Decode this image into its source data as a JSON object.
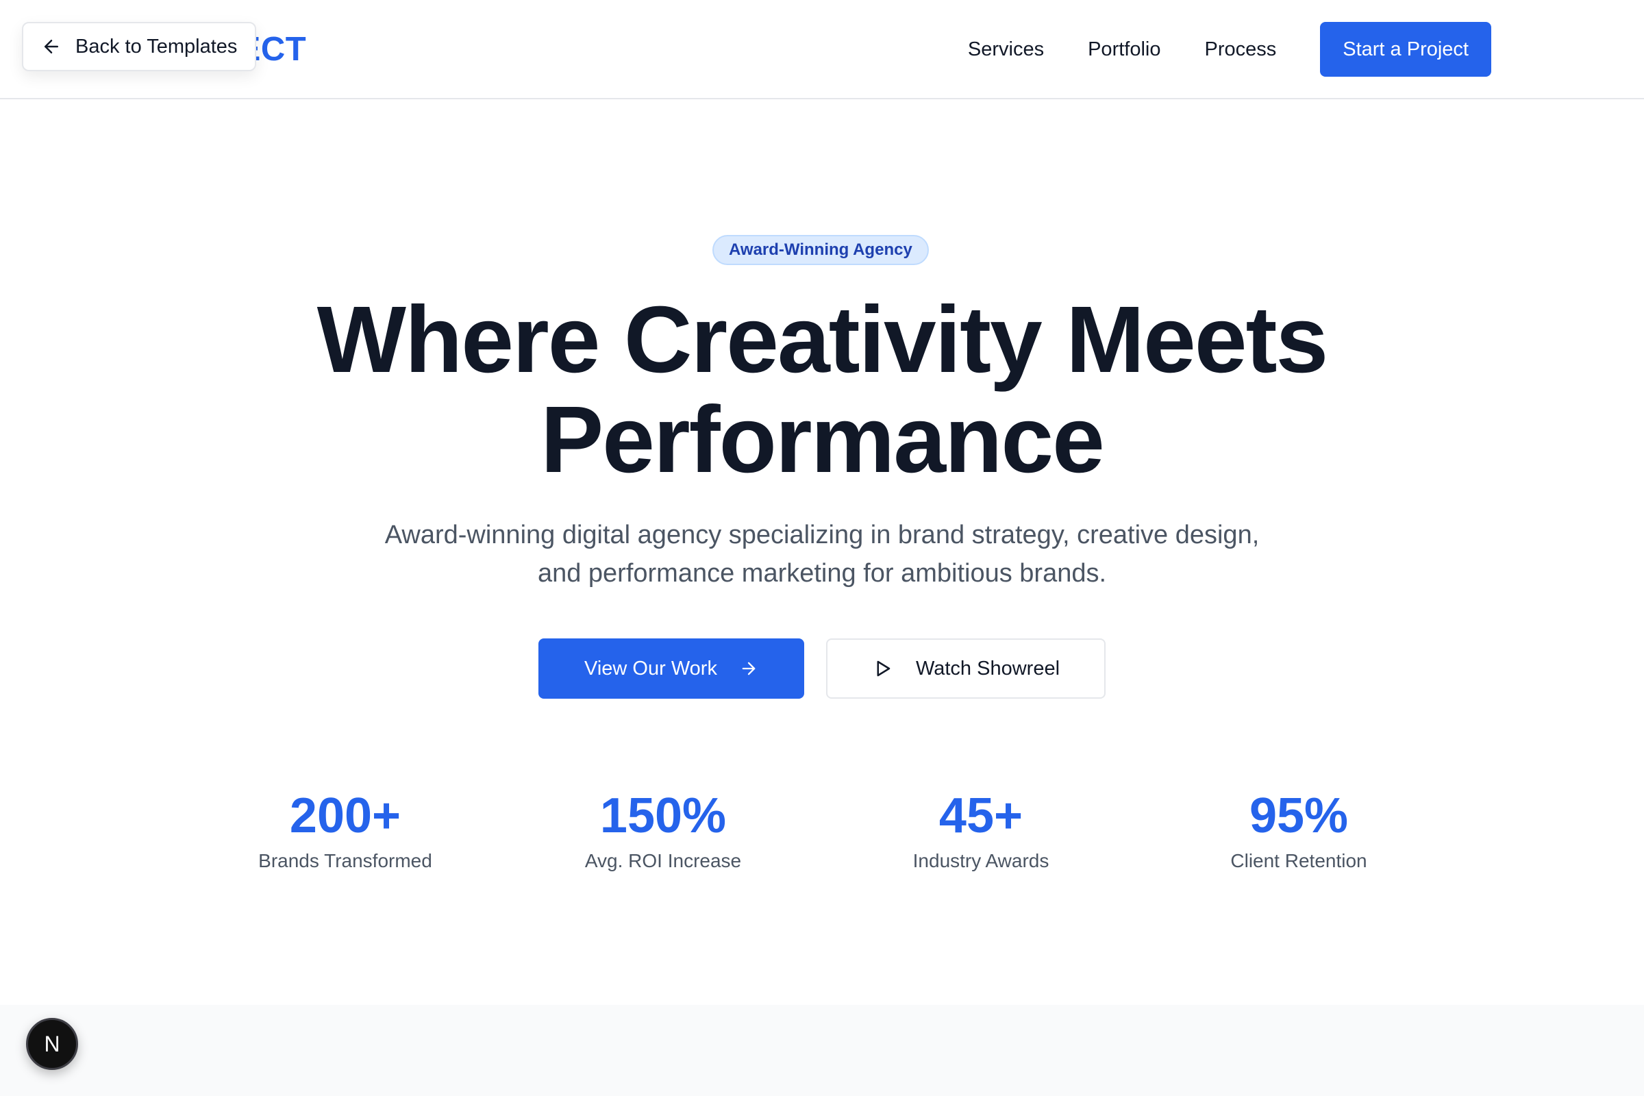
{
  "header": {
    "logo_text": "PERFECT",
    "nav": [
      "Services",
      "Portfolio",
      "Process"
    ],
    "cta_label": "Start a Project"
  },
  "overlay": {
    "back_label": "Back to Templates"
  },
  "hero": {
    "badge": "Award-Winning Agency",
    "headline_line1": "Where Creativity Meets",
    "headline_line2": "Performance",
    "subhead_line1": "Award-winning digital agency specializing in brand strategy, creative design,",
    "subhead_line2": "and performance marketing for ambitious brands.",
    "primary_button": "View Our Work",
    "secondary_button": "Watch Showreel"
  },
  "stats": [
    {
      "value": "200+",
      "label": "Brands Transformed"
    },
    {
      "value": "150%",
      "label": "Avg. ROI Increase"
    },
    {
      "value": "45+",
      "label": "Industry Awards"
    },
    {
      "value": "95%",
      "label": "Client Retention"
    }
  ],
  "dev_badge": {
    "letter": "N"
  },
  "colors": {
    "accent": "#2563eb",
    "text": "#111827",
    "muted": "#4b5563"
  },
  "icons": [
    "arrow-left-icon",
    "arrow-right-icon",
    "play-icon"
  ]
}
